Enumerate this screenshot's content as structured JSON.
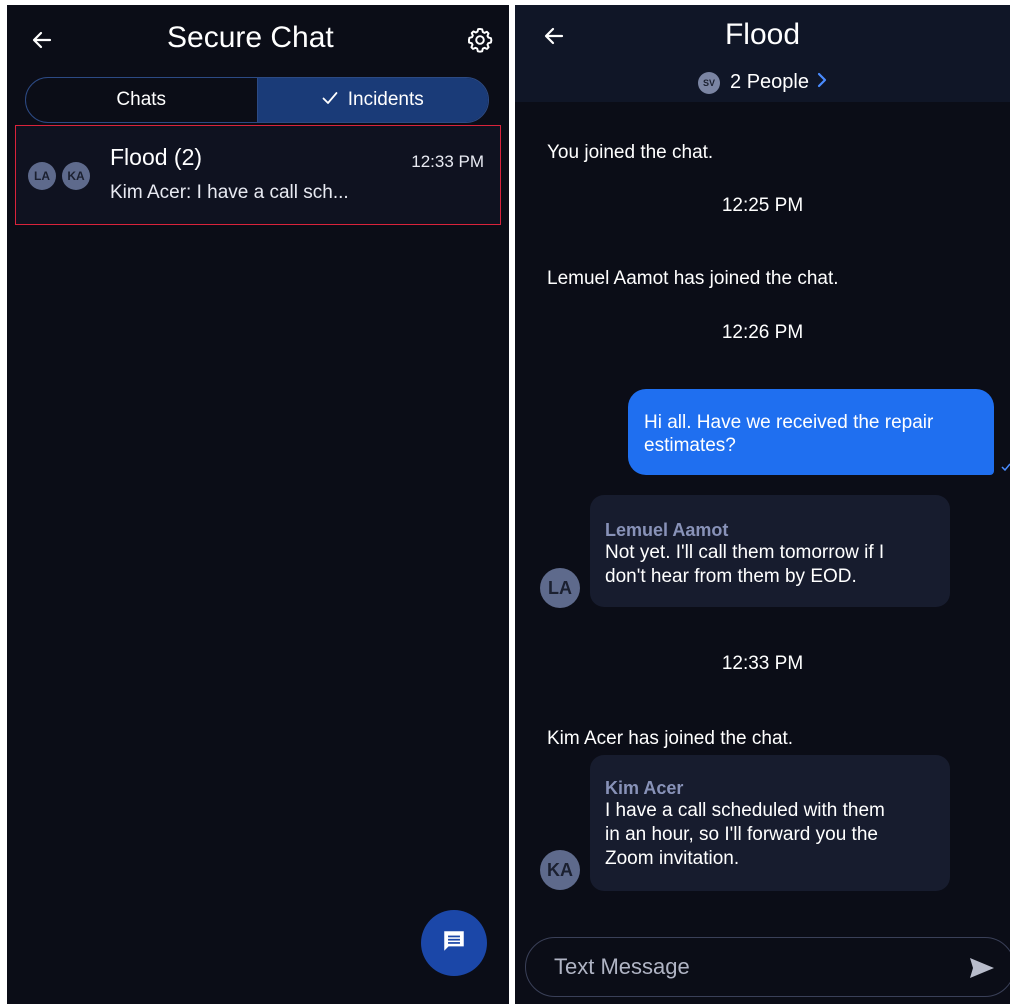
{
  "left": {
    "title": "Secure Chat",
    "tabs": [
      {
        "label": "Chats",
        "active": false
      },
      {
        "label": "Incidents",
        "active": true
      }
    ],
    "conversations": [
      {
        "avatars": [
          "LA",
          "KA"
        ],
        "name": "Flood (2)",
        "time": "12:33 PM",
        "preview": "Kim Acer: I have a call sch..."
      }
    ],
    "icons": {
      "back": "arrow-left-icon",
      "settings": "gear-icon",
      "fab": "new-message-icon",
      "check": "check-icon"
    }
  },
  "right": {
    "title": "Flood",
    "participants": {
      "avatar": "SV",
      "label": "2 People"
    },
    "timeline": {
      "sys1": "You joined the chat.",
      "ts1": "12:25 PM",
      "sys2": "Lemuel Aamot has joined the chat.",
      "ts2": "12:26 PM",
      "outgoing": "Hi all. Have we received the repair estimates?",
      "msg1": {
        "avatar": "LA",
        "sender": "Lemuel Aamot",
        "text": "Not yet. I'll call them tomorrow if I\ndon't hear from them by EOD."
      },
      "ts3": "12:33 PM",
      "sys3": "Kim Acer has joined the chat.",
      "msg2": {
        "avatar": "KA",
        "sender": "Kim Acer",
        "text": "I have a call scheduled with them\nin an hour, so I'll forward you the\nZoom invitation."
      }
    },
    "composer": {
      "placeholder": "Text Message"
    },
    "colors": {
      "accent": "#1f6ff0",
      "background": "#0b0d17",
      "incoming": "#171c2e"
    }
  }
}
